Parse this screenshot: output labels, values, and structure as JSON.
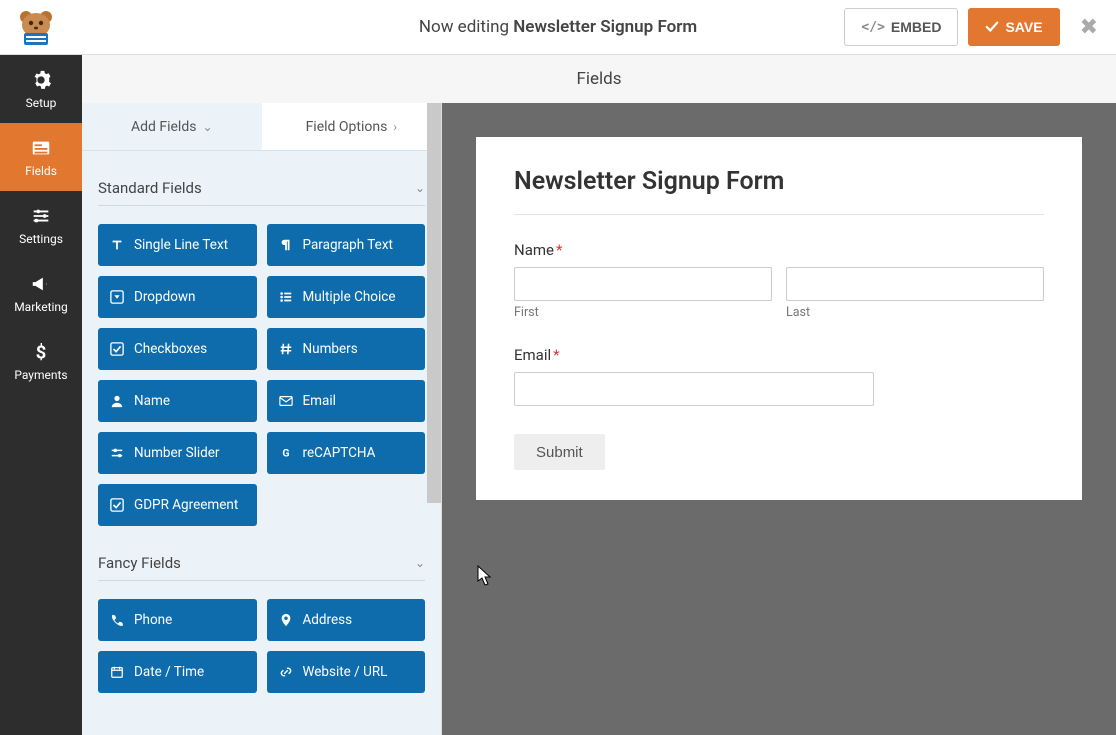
{
  "topbar": {
    "editing_prefix": "Now editing ",
    "form_name": "Newsletter Signup Form",
    "embed_label": "EMBED",
    "save_label": "SAVE"
  },
  "leftnav": {
    "setup": "Setup",
    "fields": "Fields",
    "settings": "Settings",
    "marketing": "Marketing",
    "payments": "Payments"
  },
  "subheader": {
    "title": "Fields"
  },
  "panel": {
    "tabs": {
      "add_fields": "Add Fields",
      "field_options": "Field Options"
    },
    "sections": {
      "standard": {
        "title": "Standard Fields",
        "items": {
          "single_line": "Single Line Text",
          "paragraph": "Paragraph Text",
          "dropdown": "Dropdown",
          "multiple_choice": "Multiple Choice",
          "checkboxes": "Checkboxes",
          "numbers": "Numbers",
          "name": "Name",
          "email": "Email",
          "number_slider": "Number Slider",
          "recaptcha": "reCAPTCHA",
          "gdpr": "GDPR Agreement"
        }
      },
      "fancy": {
        "title": "Fancy Fields",
        "items": {
          "phone": "Phone",
          "address": "Address",
          "datetime": "Date / Time",
          "website": "Website / URL"
        }
      }
    }
  },
  "preview": {
    "title": "Newsletter Signup Form",
    "name_label": "Name",
    "name_required": "*",
    "first_sublabel": "First",
    "last_sublabel": "Last",
    "email_label": "Email",
    "email_required": "*",
    "submit_label": "Submit"
  },
  "colors": {
    "accent": "#e27730",
    "field_btn": "#0e6cad"
  }
}
